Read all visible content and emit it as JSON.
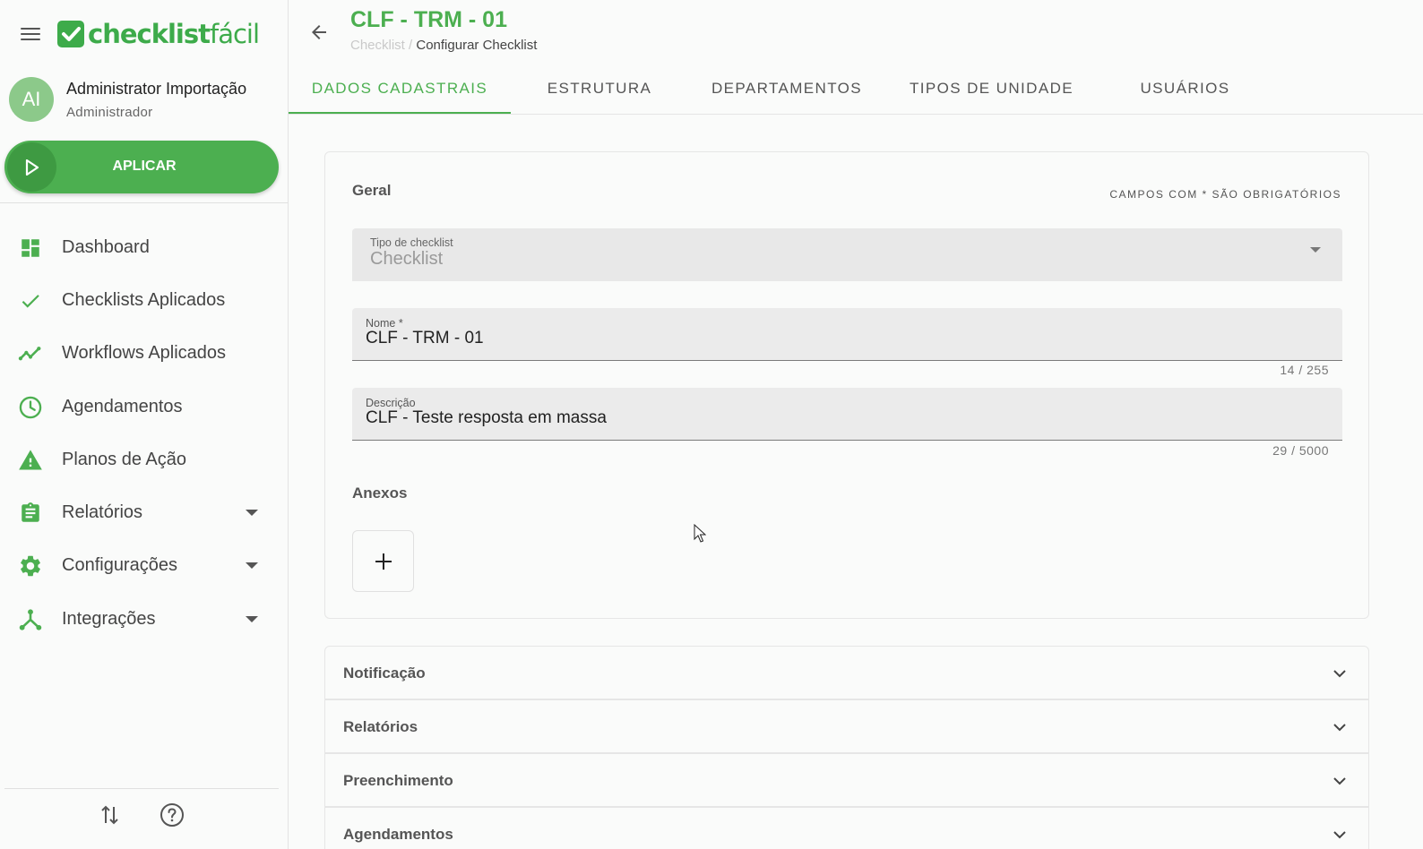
{
  "sidebar": {
    "logo": {
      "bold": "checklist",
      "light": "fácil"
    },
    "user": {
      "initials": "AI",
      "name": "Administrator Importação",
      "role": "Administrador"
    },
    "apply_label": "APLICAR",
    "items": [
      {
        "label": "Dashboard",
        "icon": "dashboard-icon",
        "expandable": false
      },
      {
        "label": "Checklists Aplicados",
        "icon": "check-icon",
        "expandable": false
      },
      {
        "label": "Workflows Aplicados",
        "icon": "trending-icon",
        "expandable": false
      },
      {
        "label": "Agendamentos",
        "icon": "clock-icon",
        "expandable": false
      },
      {
        "label": "Planos de Ação",
        "icon": "warning-icon",
        "expandable": false
      },
      {
        "label": "Relatórios",
        "icon": "clipboard-icon",
        "expandable": true
      },
      {
        "label": "Configurações",
        "icon": "gear-icon",
        "expandable": true
      },
      {
        "label": "Integrações",
        "icon": "integration-icon",
        "expandable": true
      }
    ]
  },
  "header": {
    "title": "CLF - TRM - 01",
    "breadcrumb": {
      "link": "Checklist",
      "separator": "/",
      "current": "Configurar Checklist"
    }
  },
  "tabs": [
    {
      "label": "DADOS CADASTRAIS",
      "active": true
    },
    {
      "label": "ESTRUTURA",
      "active": false
    },
    {
      "label": "DEPARTAMENTOS",
      "active": false
    },
    {
      "label": "TIPOS DE UNIDADE",
      "active": false
    },
    {
      "label": "USUÁRIOS",
      "active": false
    }
  ],
  "general": {
    "title": "Geral",
    "required_note": "CAMPOS COM * SÃO OBRIGATÓRIOS",
    "type_field": {
      "label": "Tipo de checklist",
      "value": "Checklist"
    },
    "name_field": {
      "label": "Nome *",
      "value": "CLF - TRM - 01",
      "counter": "14 / 255"
    },
    "description_field": {
      "label": "Descrição",
      "value": "CLF - Teste resposta em massa",
      "counter": "29 / 5000"
    },
    "attachments_title": "Anexos",
    "add_symbol": "+"
  },
  "accordions": [
    {
      "label": "Notificação"
    },
    {
      "label": "Relatórios"
    },
    {
      "label": "Preenchimento"
    },
    {
      "label": "Agendamentos"
    }
  ],
  "colors": {
    "brand": "#4caf50",
    "brand_dark": "#3e9a42",
    "avatar": "#8cc98a"
  }
}
